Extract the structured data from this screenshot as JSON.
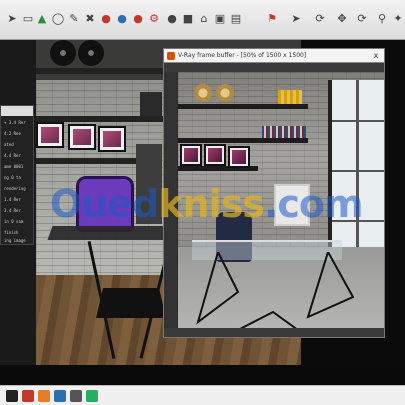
{
  "toolbar": {
    "icons": [
      "select-icon",
      "eraser-icon",
      "paint-bucket-icon",
      "tape-measure-icon",
      "pencil-icon",
      "scissors-icon",
      "render-icon",
      "material-icon",
      "teapot-icon",
      "home-icon",
      "camera-icon",
      "orbit-icon",
      "zoom-icon",
      "section-icon",
      "layers-icon"
    ]
  },
  "frame_buffer": {
    "title": "V-Ray frame buffer - [50% of 1500 x 1500]",
    "close_label": "x"
  },
  "panel": {
    "lines": [
      "+ 3.4 Rer",
      "4.2 Ree",
      "ated",
      "4.4 Rer",
      "ame 0001",
      "ng 0 ta",
      "rendering",
      "1.4 Rer",
      "3.4 Rer",
      "in 0 sam",
      "finish",
      "ing image"
    ]
  },
  "watermark": {
    "part1": "Oued",
    "part2": "kniss",
    "part3": ".com"
  },
  "colors": {
    "chair": "#6b3bbb",
    "watermark_blue": "#1e5ac8",
    "watermark_yellow": "#e6b41e"
  }
}
